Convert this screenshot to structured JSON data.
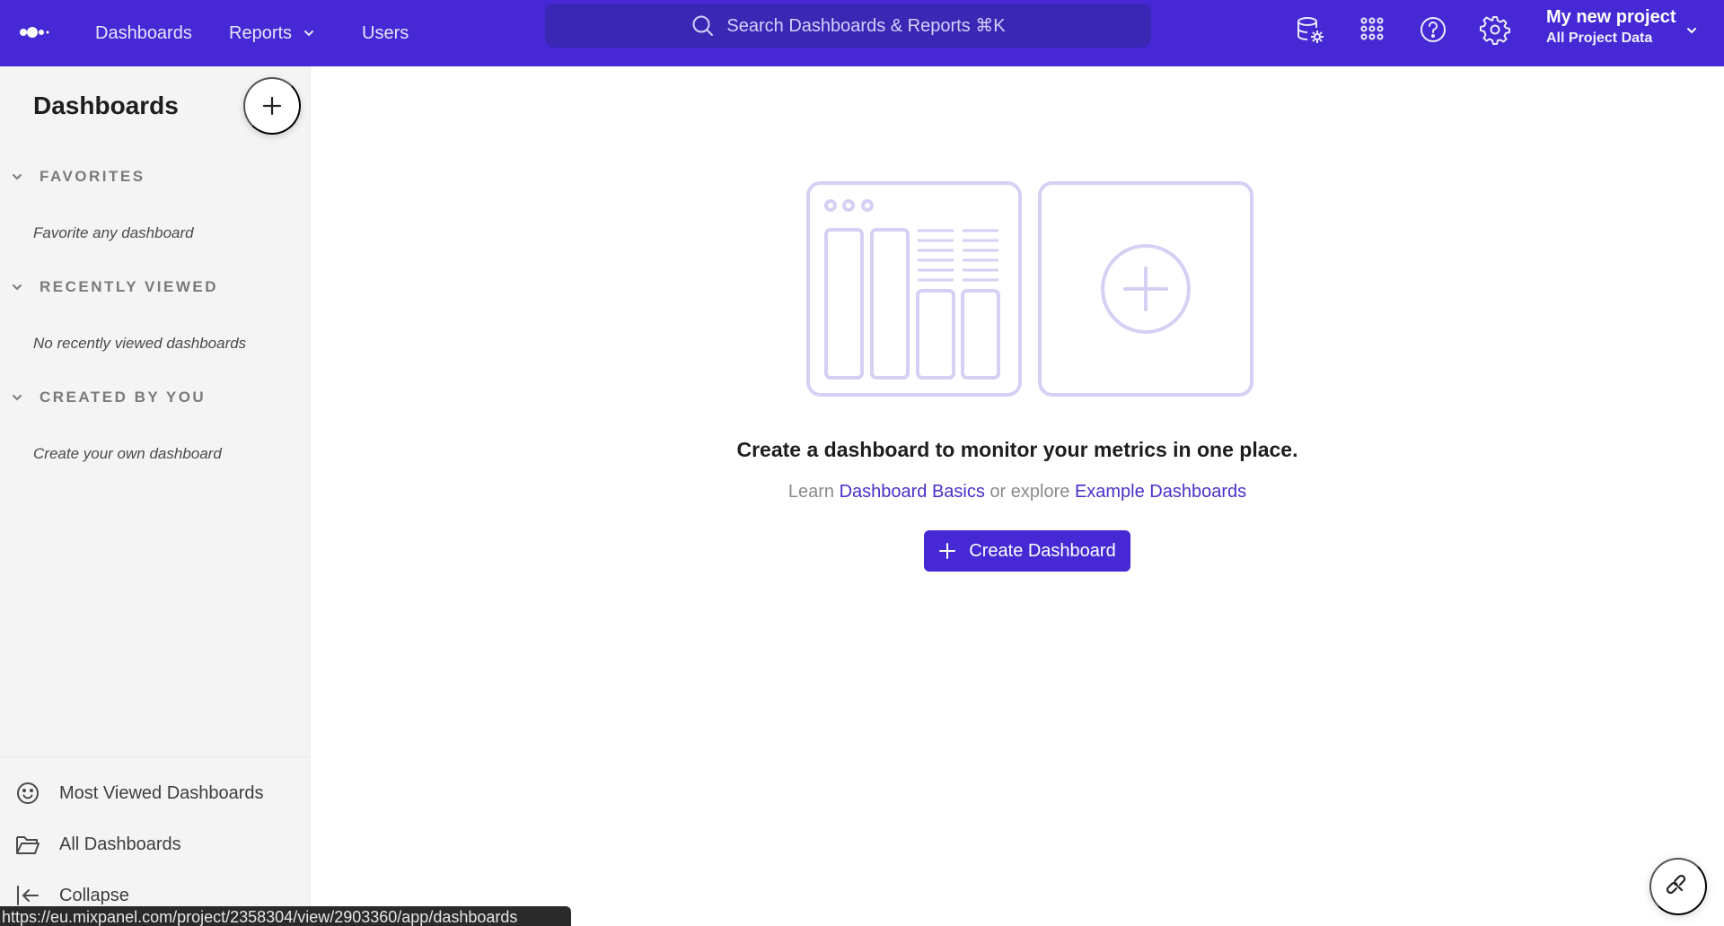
{
  "topbar": {
    "nav": [
      {
        "label": "Dashboards"
      },
      {
        "label": "Reports",
        "icon": "chevron-down-icon"
      },
      {
        "label": "Users"
      }
    ],
    "search_placeholder": "Search Dashboards & Reports ⌘K",
    "icons": [
      "data-settings-icon",
      "apps-grid-icon",
      "help-icon",
      "gear-icon"
    ],
    "project": {
      "name": "My new project",
      "scope": "All Project Data"
    }
  },
  "sidebar": {
    "title": "Dashboards",
    "sections": [
      {
        "label": "FAVORITES",
        "empty_text": "Favorite any dashboard"
      },
      {
        "label": "RECENTLY VIEWED",
        "empty_text": "No recently viewed dashboards"
      },
      {
        "label": "CREATED BY YOU",
        "empty_text": "Create your own dashboard"
      }
    ],
    "links": [
      {
        "label": "Most Viewed Dashboards",
        "icon": "smiley-icon"
      },
      {
        "label": "All Dashboards",
        "icon": "folder-icon"
      },
      {
        "label": "Collapse",
        "icon": "collapse-arrow-icon"
      }
    ]
  },
  "main": {
    "headline": "Create a dashboard to monitor your metrics in one place.",
    "sub_learn": "Learn ",
    "link_basics": "Dashboard Basics",
    "sub_or": " or explore ",
    "link_examples": "Example Dashboards",
    "cta_label": "Create Dashboard"
  },
  "status_url": "https://eu.mixpanel.com/project/2358304/view/2903360/app/dashboards",
  "colors": {
    "brand": "#4628d4",
    "link": "#4a2fc9",
    "illustration": "#d6d0f4"
  }
}
